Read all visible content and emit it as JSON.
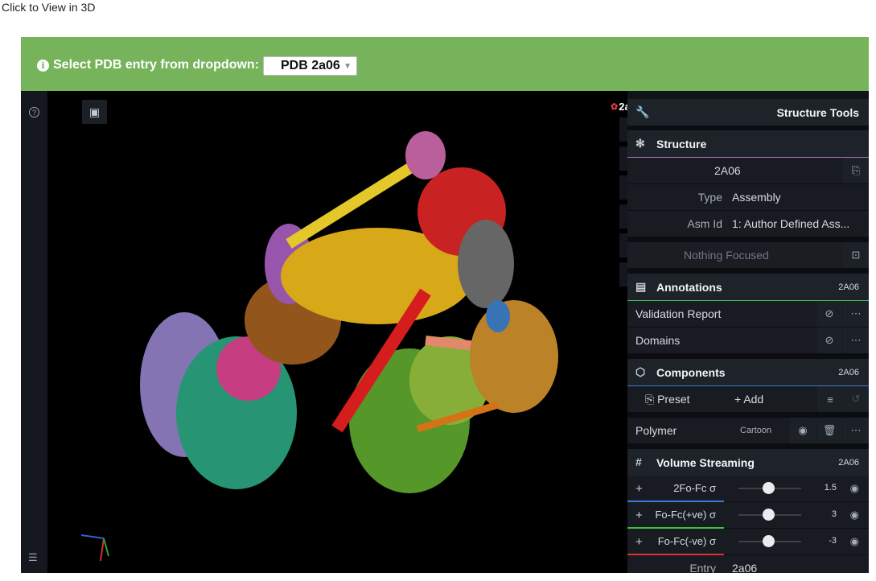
{
  "page": {
    "top_link": "Click to View in 3D"
  },
  "banner": {
    "label": "Select PDB entry from dropdown:",
    "select_value": "PDB 2a06",
    "color": "#76b35b"
  },
  "viewer": {
    "pdb_id": "2a06",
    "tool_icons": [
      "reset-view-icon",
      "screenshot-icon",
      "wrench-icon",
      "expand-icon",
      "settings-icon",
      "cursor-icon"
    ]
  },
  "panel": {
    "structure_tools": {
      "title": "Structure Tools"
    },
    "structure": {
      "title": "Structure",
      "entry": "2A06",
      "type_label": "Type",
      "type_value": "Assembly",
      "asm_label": "Asm Id",
      "asm_value": "1: Author Defined Ass...",
      "focus_text": "Nothing Focused"
    },
    "annotations": {
      "title": "Annotations",
      "entry": "2A06",
      "items": [
        {
          "label": "Validation Report"
        },
        {
          "label": "Domains"
        }
      ]
    },
    "components": {
      "title": "Components",
      "entry": "2A06",
      "preset_label": "Preset",
      "add_label": "+ Add",
      "polymer_label": "Polymer",
      "polymer_repr": "Cartoon"
    },
    "volume_streaming": {
      "title": "Volume Streaming",
      "entry": "2A06",
      "channels": [
        {
          "name": "2Fo-Fc σ",
          "value": "1.5",
          "color": "#3b7bd6"
        },
        {
          "name": "Fo-Fc(+ve) σ",
          "value": "3",
          "color": "#3ebf3e"
        },
        {
          "name": "Fo-Fc(-ve) σ",
          "value": "-3",
          "color": "#e03030"
        }
      ],
      "entry_label": "Entry",
      "entry_value": "2a06"
    }
  }
}
